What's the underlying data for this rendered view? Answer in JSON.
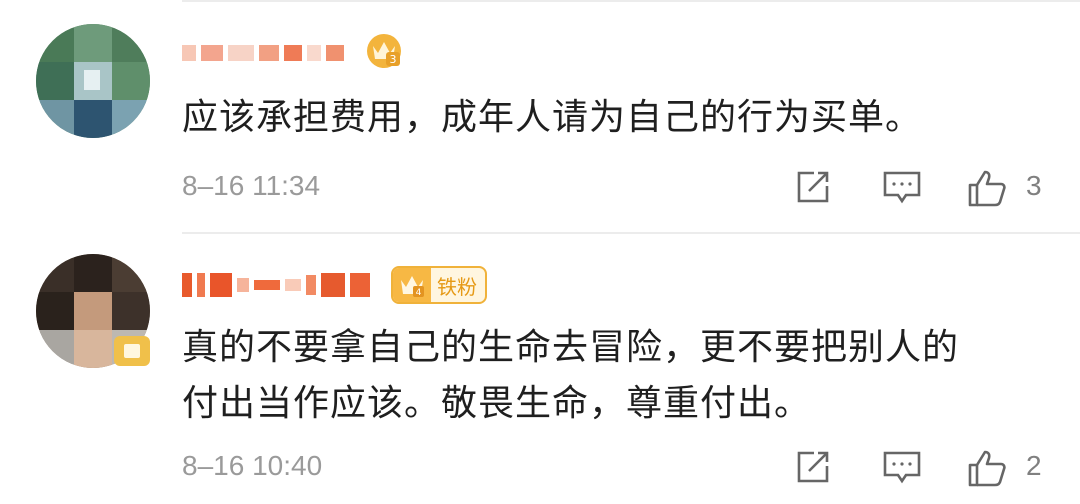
{
  "comments": [
    {
      "text": "应该承担费用，成年人请为自己的行为买单。",
      "time": "8–16 11:34",
      "likes": "3",
      "badge_level_icon": "vip-crown-icon"
    },
    {
      "text_line1": "真的不要拿自己的生命去冒险，更不要把别人的",
      "text_line2": "付出当作应该。敬畏生命，尊重付出。",
      "time": "8–16 10:40",
      "likes": "2",
      "fan_badge": "铁粉"
    }
  ],
  "icons": {
    "share": "share-icon",
    "comment": "comment-icon",
    "like": "thumbs-up-icon"
  },
  "colors": {
    "badge_gold": "#f0b23a",
    "name_red": "#ef5a28",
    "meta_gray": "#9a9a9a"
  }
}
